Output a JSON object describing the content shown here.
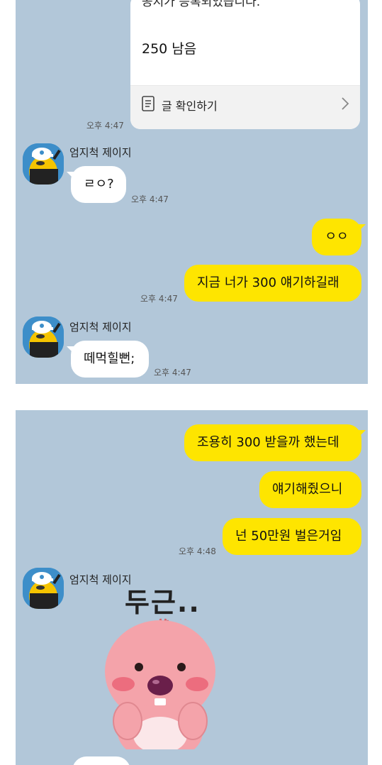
{
  "panel1": {
    "notice": {
      "top_text": "공지가 등록되었습니다.",
      "count": "250 남음",
      "link": "글 확인하기",
      "time": "오후 4:47"
    },
    "sender_name": "엄지척 제이지",
    "msg1": {
      "text": "ㄹㅇ?",
      "time": "오후 4:47"
    },
    "msg2": {
      "text": "ㅇㅇ"
    },
    "msg3": {
      "text": "지금 너가 300 얘기하길래",
      "time": "오후 4:47"
    },
    "msg4": {
      "text": "떼먹힐뻔;",
      "time": "오후 4:47"
    }
  },
  "panel2": {
    "msg1": {
      "text": "조용히 300 받을까 했는데"
    },
    "msg2": {
      "text": "얘기해줬으니"
    },
    "msg3": {
      "text": "넌 50만원 벌은거임",
      "time": "오후 4:48"
    },
    "sender_name": "엄지척 제이지",
    "sticker_text": "두근.."
  },
  "colors": {
    "chat_bg": "#b2c7d9",
    "my_bubble": "#fee500",
    "other_bubble": "#ffffff"
  },
  "icons": [
    "document-icon",
    "chevron-right-icon",
    "avatar-icon",
    "beaver-sticker"
  ]
}
